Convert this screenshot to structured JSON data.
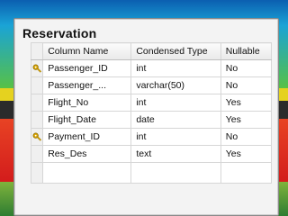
{
  "table": {
    "title": "Reservation",
    "headers": [
      "Column Name",
      "Condensed Type",
      "Nullable"
    ],
    "rows": [
      {
        "name": "Passenger_ID",
        "type": "int",
        "nullable": "No",
        "key": true
      },
      {
        "name": "Passenger_...",
        "type": "varchar(50)",
        "nullable": "No",
        "key": false
      },
      {
        "name": "Flight_No",
        "type": "int",
        "nullable": "Yes",
        "key": false
      },
      {
        "name": "Flight_Date",
        "type": "date",
        "nullable": "Yes",
        "key": false
      },
      {
        "name": "Payment_ID",
        "type": "int",
        "nullable": "No",
        "key": true
      },
      {
        "name": "Res_Des",
        "type": "text",
        "nullable": "Yes",
        "key": false
      }
    ]
  },
  "colors": {
    "key_icon": "#d9a400"
  },
  "icons": {
    "primary_key": "key-icon"
  }
}
